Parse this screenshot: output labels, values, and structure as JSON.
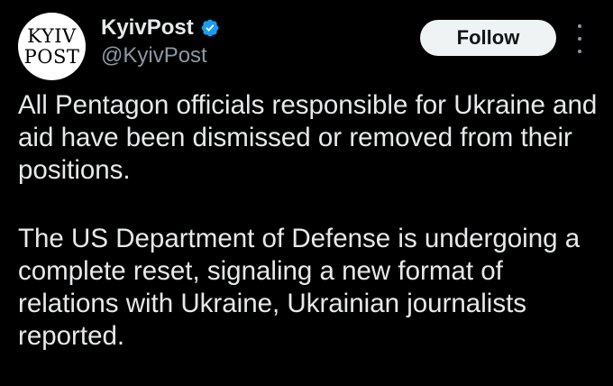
{
  "tweet": {
    "avatar": {
      "line1": "KYIV",
      "line2": "POST"
    },
    "author_name": "KyivPost",
    "handle": "@KyivPost",
    "verified_color": "#1d9bf0",
    "follow_label": "Follow",
    "more_icon": "more-vertical-icon",
    "paragraphs": [
      "All Pentagon officials responsible for Ukraine and aid have been dismissed or removed from their positions.",
      "The US Department of Defense is undergoing a complete reset, signaling a new format of relations with Ukraine, Ukrainian journalists reported."
    ]
  }
}
